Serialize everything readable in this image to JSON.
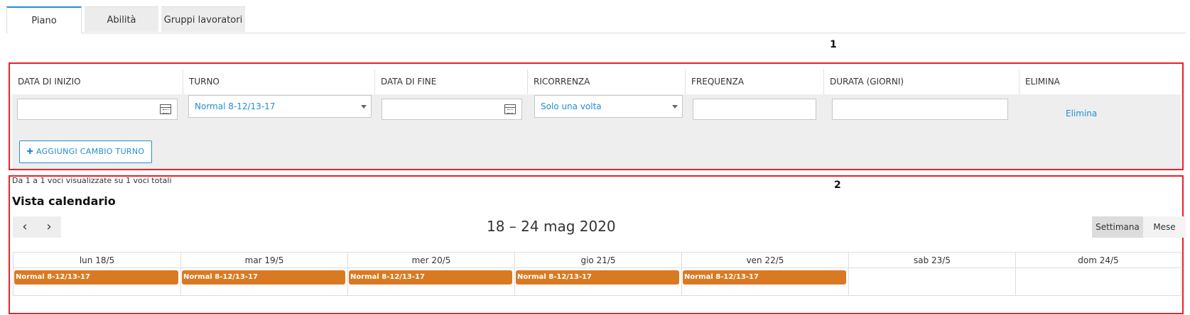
{
  "tabs": [
    {
      "label": "Piano",
      "active": true
    },
    {
      "label": "Abilità",
      "active": false
    },
    {
      "label": "Gruppi lavoratori",
      "active": false
    }
  ],
  "section_numbers": {
    "first": "1",
    "second": "2"
  },
  "shift_table": {
    "headers": [
      "DATA DI INIZIO",
      "TURNO",
      "DATA DI FINE",
      "RICORRENZA",
      "FREQUENZA",
      "DURATA (GIORNI)",
      "ELIMINA"
    ],
    "row": {
      "start_date": "",
      "shift": "Normal 8-12/13-17",
      "end_date": "",
      "recurrence": "Solo una volta",
      "frequency": "",
      "duration": "",
      "delete_label": "Elimina"
    },
    "add_button": "✚ AGGIUNGI CAMBIO TURNO"
  },
  "summary": "Da 1 a 1 voci visualizzate su 1 voci totali",
  "calendar": {
    "title": "Vista calendario",
    "prev": "‹",
    "next": "›",
    "range": "18 – 24 mag 2020",
    "views": [
      "Settimana",
      "Mese"
    ],
    "active_view": "Settimana",
    "days": [
      {
        "label": "lun 18/5",
        "event": "Normal 8-12/13-17"
      },
      {
        "label": "mar 19/5",
        "event": "Normal 8-12/13-17"
      },
      {
        "label": "mer 20/5",
        "event": "Normal 8-12/13-17"
      },
      {
        "label": "gio 21/5",
        "event": "Normal 8-12/13-17"
      },
      {
        "label": "ven 22/5",
        "event": "Normal 8-12/13-17"
      },
      {
        "label": "sab 23/5",
        "event": ""
      },
      {
        "label": "dom 24/5",
        "event": ""
      }
    ],
    "event_color": "#d97a22"
  },
  "colors": {
    "accent": "#1f8fcf",
    "highlight_border": "#e8202a"
  }
}
